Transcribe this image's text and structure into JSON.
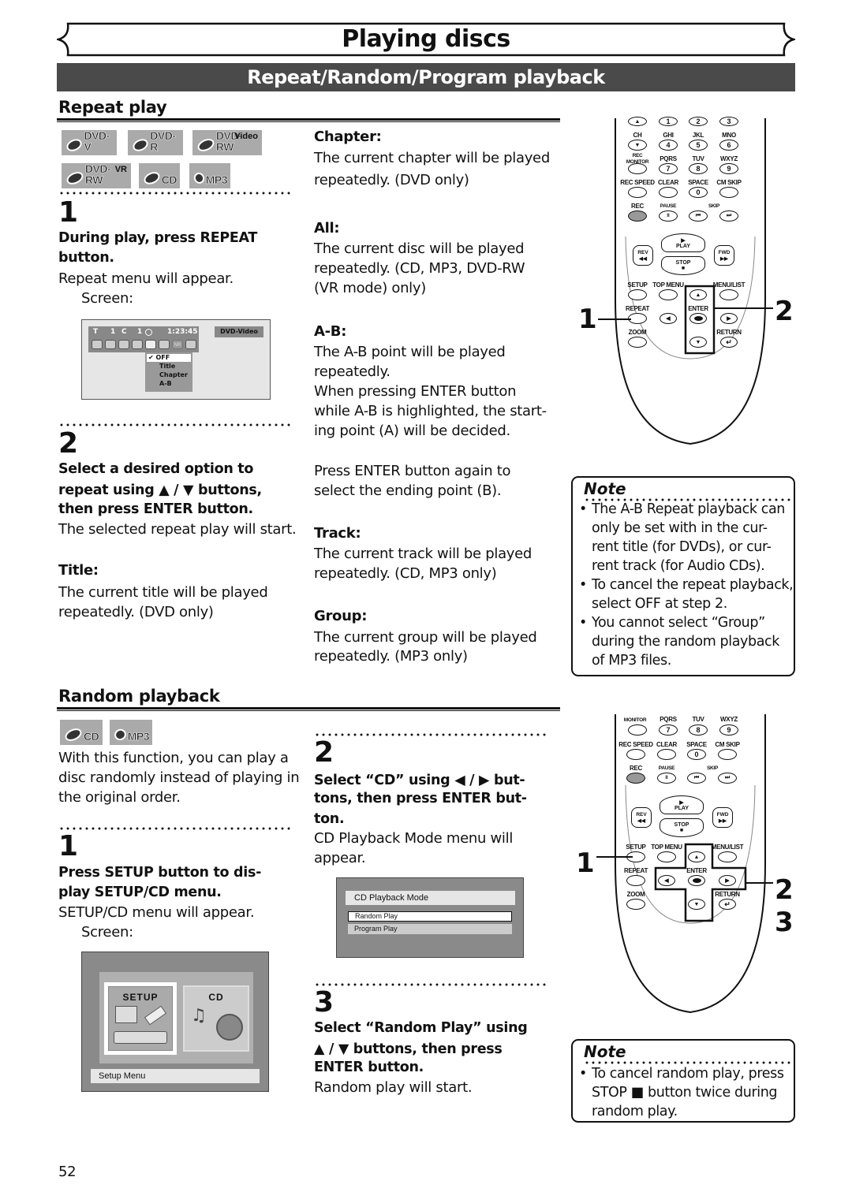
{
  "page": {
    "chapter_title": "Playing discs",
    "section_title": "Repeat/Random/Program playback",
    "page_number": "52"
  },
  "repeat": {
    "heading": "Repeat play",
    "disc_badges": [
      {
        "label": "DVD-V",
        "sup": ""
      },
      {
        "label": "DVD-R",
        "sup": ""
      },
      {
        "label": "DVD-RW",
        "sup": "Video"
      },
      {
        "label": "DVD-RW",
        "sup": "VR"
      },
      {
        "label": "CD",
        "sup": ""
      },
      {
        "label": "MP3",
        "sup": ""
      }
    ],
    "step1": {
      "num": "1",
      "instruction": "During play, press REPEAT button.",
      "result": "Repeat menu will appear.",
      "screen_label": "Screen:"
    },
    "osd": {
      "title_icon": "T",
      "title_num": "1",
      "chapter_icon": "C",
      "chapter_num": "1",
      "time": "1:23:45",
      "disc_type": "DVD-Video",
      "icons": [
        "subtitle-icon",
        "audio-icon",
        "caption-icon",
        "angle-icon",
        "repeat-icon",
        "marker-icon",
        "nr-icon",
        "zoom-icon"
      ],
      "nr_label": "NR",
      "menu_check": "✔",
      "menu_items": [
        "OFF",
        "Title",
        "Chapter",
        "A-B"
      ],
      "selected_index": 0
    },
    "step2": {
      "num": "2",
      "instruction_line1": "Select a desired option to",
      "instruction_line2": "repeat using ▲ / ▼ buttons,",
      "instruction_line3": "then press ENTER button.",
      "result": "The selected repeat play will start."
    },
    "options": [
      {
        "label": "Title:",
        "desc": [
          "The current title will be played",
          "repeatedly. (DVD only)"
        ]
      },
      {
        "label": "Chapter:",
        "desc": [
          "The current chapter will be played",
          "repeatedly. (DVD only)"
        ]
      },
      {
        "label": "All:",
        "desc": [
          "The current disc will be played",
          "repeatedly. (CD, MP3, DVD-RW",
          "(VR mode) only)"
        ]
      },
      {
        "label": "A-B:",
        "desc": [
          "The A-B point will be played",
          "repeatedly.",
          "When pressing ENTER button",
          "while A-B is highlighted, the start-",
          "ing point (A) will be decided.",
          "",
          "Press ENTER button again to",
          "select the ending point (B)."
        ]
      },
      {
        "label": "Track:",
        "desc": [
          "The current track will be played",
          "repeatedly. (CD, MP3 only)"
        ]
      },
      {
        "label": "Group:",
        "desc": [
          "The current group will be played",
          "repeatedly. (MP3 only)"
        ]
      }
    ],
    "note": {
      "title": "Note",
      "items": [
        "The A-B Repeat playback can only be set with in the current title (for DVDs), or current track (for Audio CDs).",
        "To cancel the repeat playback, select OFF at step 2.",
        "You cannot select “Group” during the random playback of MP3 files."
      ],
      "item_lines": [
        [
          "The A-B Repeat playback can",
          "only be set with in the cur-",
          "rent title (for DVDs), or cur-",
          "rent track (for Audio CDs)."
        ],
        [
          "To cancel the repeat playback,",
          "select OFF at step 2."
        ],
        [
          "You cannot select “Group”",
          "during the random playback",
          "of MP3 files."
        ]
      ]
    },
    "callouts": [
      "1",
      "2"
    ]
  },
  "random": {
    "heading": "Random playback",
    "disc_badges": [
      {
        "label": "CD",
        "sup": ""
      },
      {
        "label": "MP3",
        "sup": ""
      }
    ],
    "intro": [
      "With this function, you can play a",
      "disc randomly instead of playing in",
      "the original order."
    ],
    "step1": {
      "num": "1",
      "instruction_line1": "Press SETUP button to dis-",
      "instruction_line2": "play SETUP/CD menu.",
      "result": "SETUP/CD menu will appear.",
      "screen_label": "Screen:"
    },
    "setup_screen": {
      "tile1": "SETUP",
      "tile2": "CD",
      "status": "Setup Menu"
    },
    "step2": {
      "num": "2",
      "instruction_line1": "Select “CD” using ◀ / ▶ but-",
      "instruction_line2": "tons, then press ENTER but-",
      "instruction_line3": "ton.",
      "result_line1": "CD Playback Mode menu will",
      "result_line2": "appear."
    },
    "cd_menu": {
      "title": "CD Playback Mode",
      "items": [
        "Random Play",
        "Program Play"
      ],
      "selected_index": 0
    },
    "step3": {
      "num": "3",
      "instruction_line1": "Select “Random Play” using",
      "instruction_line2": "▲ / ▼ buttons, then press",
      "instruction_line3": "ENTER button.",
      "result": "Random play will start."
    },
    "note": {
      "title": "Note",
      "item_lines": [
        "To cancel random play, press",
        "STOP ■ button twice during",
        "random play."
      ]
    },
    "callouts": [
      "1",
      "2",
      "3"
    ]
  },
  "remote": {
    "labels": {
      "ch": "CH",
      "ghi": "GHI",
      "jkl": "JKL",
      "mno": "MNO",
      "rec_monitor": "REC MONITOR",
      "pqrs": "PQRS",
      "tuv": "TUV",
      "wxyz": "WXYZ",
      "rec_speed": "REC SPEED",
      "clear": "CLEAR",
      "space": "SPACE",
      "cm_skip": "CM SKIP",
      "rec": "REC",
      "pause": "PAUSE",
      "skip": "SKIP",
      "play": "PLAY",
      "stop": "STOP",
      "rev": "REV",
      "fwd": "FWD",
      "setup": "SETUP",
      "top_menu": "TOP MENU",
      "menu_list": "MENU/LIST",
      "repeat": "REPEAT",
      "enter": "ENTER",
      "zoom": "ZOOM",
      "return": "RETURN",
      "monitor": "MONITOR"
    },
    "digits": [
      "1",
      "2",
      "3",
      "4",
      "5",
      "6",
      "7",
      "8",
      "9",
      "0"
    ],
    "glyphs": {
      "up": "▲",
      "down": "▼",
      "left": "◀",
      "right": "▶",
      "pause": "II",
      "prev": "⏮",
      "next": "⏭",
      "rev": "◀◀",
      "fwd": "▶▶",
      "stop": "■",
      "play": "▶",
      "return": "↵"
    }
  }
}
